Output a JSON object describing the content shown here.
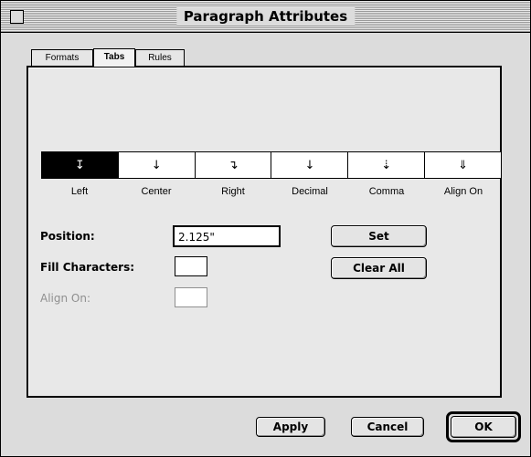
{
  "window": {
    "title": "Paragraph Attributes"
  },
  "tabs": [
    {
      "label": "Formats",
      "selected": false
    },
    {
      "label": "Tabs",
      "selected": true
    },
    {
      "label": "Rules",
      "selected": false
    }
  ],
  "tab_ruler": {
    "markers": [
      {
        "glyph": "↧",
        "icon": "left-tab-icon",
        "label": "Left",
        "selected": true
      },
      {
        "glyph": "↓",
        "icon": "center-tab-icon",
        "label": "Center",
        "selected": false
      },
      {
        "glyph": "↴",
        "icon": "right-tab-icon",
        "label": "Right",
        "selected": false
      },
      {
        "glyph": "↓",
        "icon": "decimal-tab-icon",
        "label": "Decimal",
        "selected": false
      },
      {
        "glyph": "⇣",
        "icon": "comma-tab-icon",
        "label": "Comma",
        "selected": false
      },
      {
        "glyph": "⇓",
        "icon": "align-on-tab-icon",
        "label": "Align On",
        "selected": false
      }
    ]
  },
  "form": {
    "position_label": "Position:",
    "position_value": "2.125\"",
    "fill_characters_label": "Fill Characters:",
    "fill_characters_value": "",
    "align_on_label": "Align On:",
    "align_on_value": ""
  },
  "buttons": {
    "set": "Set",
    "clear_all": "Clear All",
    "apply": "Apply",
    "cancel": "Cancel",
    "ok": "OK"
  }
}
